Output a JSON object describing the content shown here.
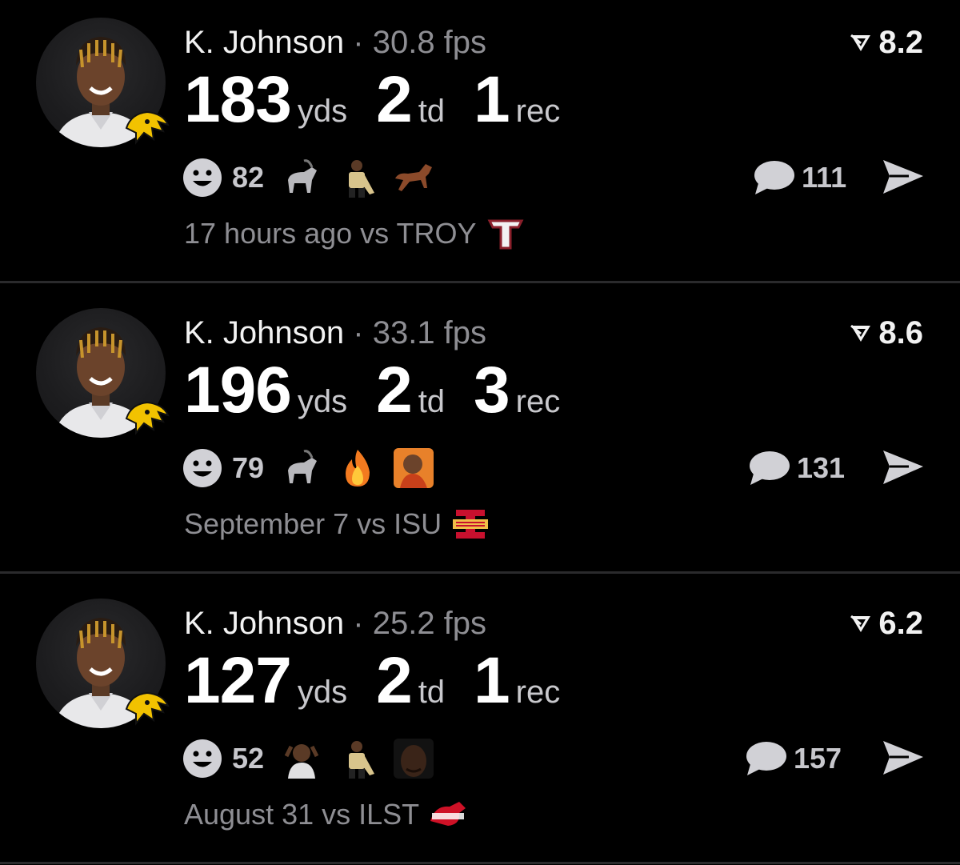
{
  "posts": [
    {
      "player": "K. Johnson",
      "separator": "·",
      "fps": "30.8 fps",
      "rating": "8.2",
      "stats": [
        {
          "value": "183",
          "unit": "yds"
        },
        {
          "value": "2",
          "unit": "td"
        },
        {
          "value": "1",
          "unit": "rec"
        }
      ],
      "reaction_count": "82",
      "reaction_emojis": [
        "goat-emoji",
        "player-photo-emoji",
        "horse-emoji"
      ],
      "comment_count": "111",
      "time_text": "17 hours ago vs TROY",
      "opponent_logo": "troy-logo",
      "colors": {
        "opponent": "#8a1f2a"
      }
    },
    {
      "player": "K. Johnson",
      "separator": "·",
      "fps": "33.1 fps",
      "rating": "8.6",
      "stats": [
        {
          "value": "196",
          "unit": "yds"
        },
        {
          "value": "2",
          "unit": "td"
        },
        {
          "value": "3",
          "unit": "rec"
        }
      ],
      "reaction_count": "79",
      "reaction_emojis": [
        "goat-emoji",
        "fire-emoji",
        "drake-meme-emoji"
      ],
      "comment_count": "131",
      "time_text": "September 7 vs ISU",
      "opponent_logo": "iowa-state-logo",
      "colors": {
        "opponent": "#c8102e"
      }
    },
    {
      "player": "K. Johnson",
      "separator": "·",
      "fps": "25.2 fps",
      "rating": "6.2",
      "stats": [
        {
          "value": "127",
          "unit": "yds"
        },
        {
          "value": "2",
          "unit": "td"
        },
        {
          "value": "1",
          "unit": "rec"
        }
      ],
      "reaction_count": "52",
      "reaction_emojis": [
        "shocked-person-emoji",
        "player-photo-emoji",
        "face-photo-emoji"
      ],
      "comment_count": "157",
      "time_text": "August 31 vs ILST",
      "opponent_logo": "illinois-state-logo",
      "colors": {
        "opponent": "#ce1126"
      }
    }
  ],
  "icons": {
    "avatar": "player-avatar",
    "team_badge": "hawkeye-logo",
    "rating": "rating-triangle-icon",
    "reactions": "smiley-icon",
    "comments": "comment-bubble-icon",
    "share": "share-arrow-icon"
  },
  "colors": {
    "background": "#000000",
    "divider": "#2a2a2c",
    "secondary_text": "#8e8e93",
    "icon_gray": "#c7c7cc",
    "hawkeye_gold": "#f2c200"
  }
}
